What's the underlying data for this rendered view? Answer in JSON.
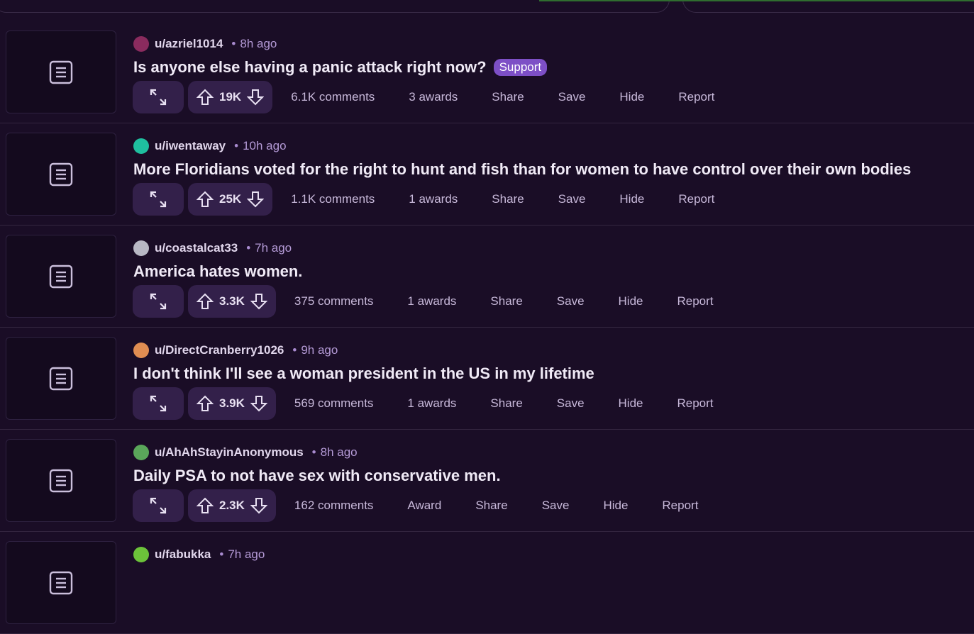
{
  "posts": [
    {
      "user": "u/azriel1014",
      "time": "8h ago",
      "title": "Is anyone else having a panic attack right now?",
      "flair": "Support",
      "votes": "19K",
      "comments": "6.1K comments",
      "awards": "3 awards",
      "share": "Share",
      "save": "Save",
      "hide": "Hide",
      "report": "Report",
      "avatar_color": "#8a2b5e"
    },
    {
      "user": "u/iwentaway",
      "time": "10h ago",
      "title": "More Floridians voted for the right to hunt and fish than for women to have control over their own bodies",
      "flair": "",
      "votes": "25K",
      "comments": "1.1K comments",
      "awards": "1 awards",
      "share": "Share",
      "save": "Save",
      "hide": "Hide",
      "report": "Report",
      "avatar_color": "#1fbf9f"
    },
    {
      "user": "u/coastalcat33",
      "time": "7h ago",
      "title": "America hates women.",
      "flair": "",
      "votes": "3.3K",
      "comments": "375 comments",
      "awards": "1 awards",
      "share": "Share",
      "save": "Save",
      "hide": "Hide",
      "report": "Report",
      "avatar_color": "#b8b8c4"
    },
    {
      "user": "u/DirectCranberry1026",
      "time": "9h ago",
      "title": "I don't think I'll see a woman president in the US in my lifetime",
      "flair": "",
      "votes": "3.9K",
      "comments": "569 comments",
      "awards": "1 awards",
      "share": "Share",
      "save": "Save",
      "hide": "Hide",
      "report": "Report",
      "avatar_color": "#e08d52"
    },
    {
      "user": "u/AhAhStayinAnonymous",
      "time": "8h ago",
      "title": "Daily PSA to not have sex with conservative men.",
      "flair": "",
      "votes": "2.3K",
      "comments": "162 comments",
      "awards": "Award",
      "share": "Share",
      "save": "Save",
      "hide": "Hide",
      "report": "Report",
      "avatar_color": "#5aa65a"
    },
    {
      "user": "u/fabukka",
      "time": "7h ago",
      "title": "",
      "flair": "",
      "votes": "",
      "comments": "",
      "awards": "",
      "share": "",
      "save": "",
      "hide": "",
      "report": "",
      "avatar_color": "#6cc23a"
    }
  ],
  "icons": {
    "thumb": "text-post-icon",
    "expand": "expand-arrows-icon",
    "upvote": "upvote-arrow-icon",
    "downvote": "downvote-arrow-icon"
  }
}
